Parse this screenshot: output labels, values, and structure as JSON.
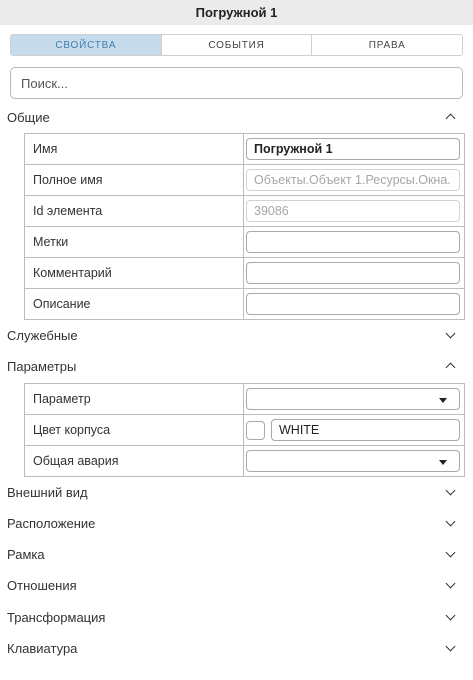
{
  "window": {
    "title": "Погружной 1"
  },
  "tabs": [
    {
      "label": "СВОЙСТВА",
      "active": true
    },
    {
      "label": "СОБЫТИЯ",
      "active": false
    },
    {
      "label": "ПРАВА",
      "active": false
    }
  ],
  "search": {
    "placeholder": "Поиск..."
  },
  "sections": {
    "general": {
      "title": "Общие",
      "expanded": true,
      "rows": {
        "name": {
          "label": "Имя",
          "value": "Погружной 1"
        },
        "full_name": {
          "label": "Полное имя",
          "value": "Объекты.Объект 1.Ресурсы.Окна."
        },
        "element_id": {
          "label": "Id элемента",
          "value": "39086"
        },
        "tags": {
          "label": "Метки",
          "value": ""
        },
        "comment": {
          "label": "Комментарий",
          "value": ""
        },
        "description": {
          "label": "Описание",
          "value": ""
        }
      }
    },
    "service": {
      "title": "Служебные",
      "expanded": false
    },
    "parameters": {
      "title": "Параметры",
      "expanded": true,
      "rows": {
        "parameter": {
          "label": "Параметр",
          "value": ""
        },
        "body_color": {
          "label": "Цвет корпуса",
          "value": "WHITE"
        },
        "general_alarm": {
          "label": "Общая авария",
          "value": ""
        }
      }
    },
    "appearance": {
      "title": "Внешний вид",
      "expanded": false
    },
    "placement": {
      "title": "Расположение",
      "expanded": false
    },
    "frame": {
      "title": "Рамка",
      "expanded": false
    },
    "relations": {
      "title": "Отношения",
      "expanded": false
    },
    "transform": {
      "title": "Трансформация",
      "expanded": false
    },
    "keyboard": {
      "title": "Клавиатура",
      "expanded": false
    }
  },
  "colors": {
    "active_tab_bg": "#c6dcec",
    "active_tab_text": "#3f7faf",
    "titlebar_bg": "#ebebeb"
  },
  "icons": {
    "expanded": "chevron-up-icon",
    "collapsed": "chevron-down-icon",
    "select": "dropdown-arrow-icon"
  }
}
